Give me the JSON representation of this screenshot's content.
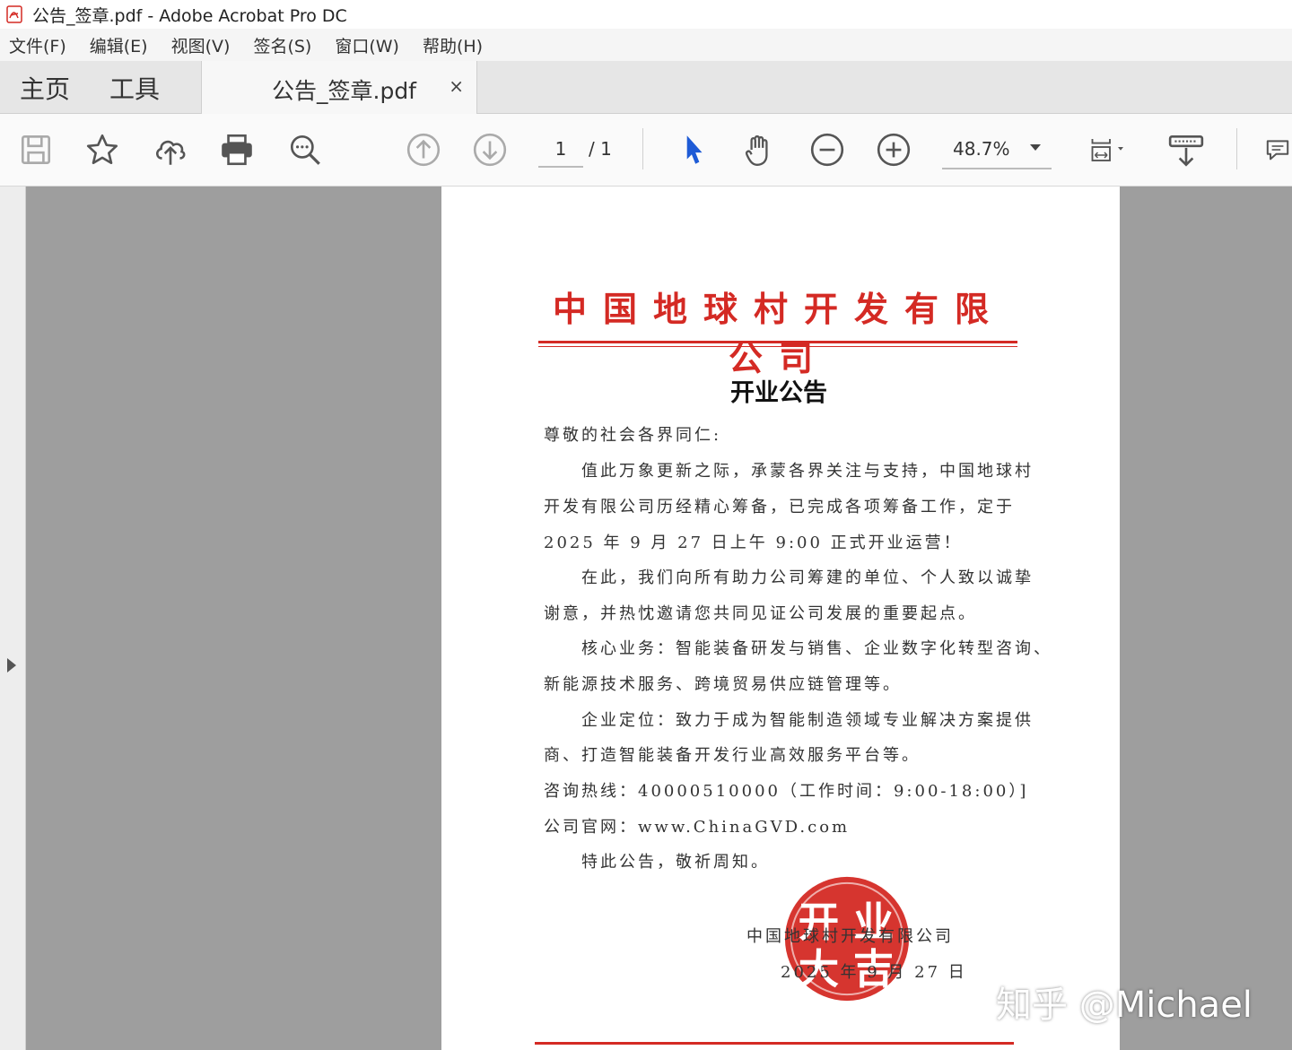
{
  "window": {
    "title": "公告_签章.pdf - Adobe Acrobat Pro DC",
    "app_icon": "acrobat-pdf-icon"
  },
  "menu": [
    "文件(F)",
    "编辑(E)",
    "视图(V)",
    "签名(S)",
    "窗口(W)",
    "帮助(H)"
  ],
  "nav_tabs": {
    "home": "主页",
    "tools": "工具"
  },
  "doc_tab": {
    "title": "公告_签章.pdf",
    "close": "×"
  },
  "toolbar": {
    "icons": [
      "save-icon",
      "bookmark-star-icon",
      "upload-cloud-icon",
      "print-icon",
      "search-zoom-icon",
      "prev-page-icon",
      "next-page-icon",
      "select-cursor-icon",
      "hand-tool-icon",
      "zoom-out-icon",
      "zoom-in-icon",
      "page-fit-icon",
      "scroll-mode-icon",
      "comment-icon"
    ],
    "page_current": "1",
    "page_total": "/ 1",
    "zoom": "48.7%"
  },
  "document": {
    "company": "中国地球村开发有限公司",
    "title": "开业公告",
    "paragraphs": [
      "尊敬的社会各界同仁:",
      "　　值此万象更新之际，承蒙各界关注与支持，中国地球村",
      "开发有限公司历经精心筹备，已完成各项筹备工作，定于",
      "2025 年 9 月 27 日上午 9:00 正式开业运营！",
      "　　在此，我们向所有助力公司筹建的单位、个人致以诚挚",
      "谢意，并热忱邀请您共同见证公司发展的重要起点。",
      "　　核心业务：智能装备研发与销售、企业数字化转型咨询、",
      "新能源技术服务、跨境贸易供应链管理等。",
      "　　企业定位：致力于成为智能制造领域专业解决方案提供",
      "商、打造智能装备开发行业高效服务平台等。",
      "咨询热线：40000510000（工作时间：9:00-18:00）]",
      "公司官网：www.ChinaGVD.com",
      "　　特此公告，敬祈周知。"
    ],
    "signature_company": "中国地球村开发有限公司",
    "signature_date": "2025 年 9 月 27 日",
    "seal_text": "开业大吉",
    "seal_color": "#d42a24"
  },
  "watermark": "知乎 @Michael"
}
